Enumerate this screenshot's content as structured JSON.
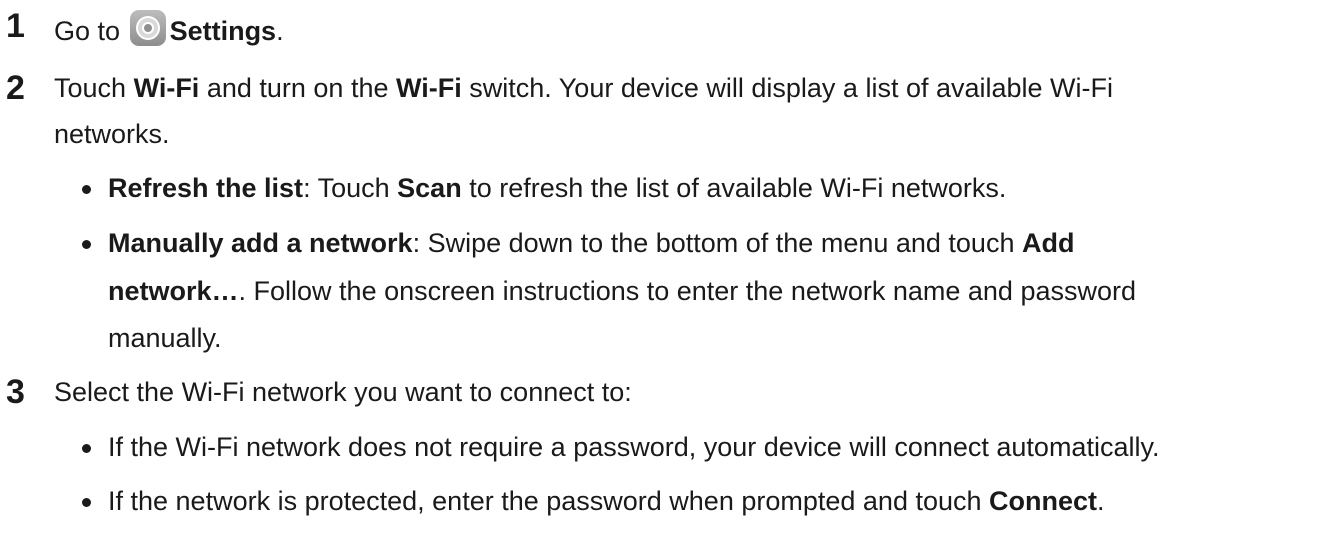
{
  "steps": [
    {
      "number": "1",
      "go_to": "Go to",
      "settings": "Settings",
      "period": ".",
      "icon": "settings-icon"
    },
    {
      "number": "2",
      "touch": "Touch",
      "wifi1": "Wi-Fi",
      "and_turn_on": "and turn on the",
      "wifi2": "Wi-Fi",
      "switch_text": "switch. Your device will display a list of available Wi-Fi",
      "cont": "networks.",
      "bullets": [
        {
          "bold1": "Refresh the list",
          "text1": ": Touch",
          "bold2": "Scan",
          "text2": "to refresh the list of available Wi-Fi networks."
        },
        {
          "bold1": "Manually add a network",
          "text1": ": Swipe down to the bottom of the menu and touch",
          "bold2": "Add",
          "bold3": "network…",
          "text2": ". Follow the onscreen instructions to enter the network name and password",
          "text3": "manually."
        }
      ]
    },
    {
      "number": "3",
      "text": "Select the Wi-Fi network you want to connect to:",
      "bullets": [
        {
          "text": "If the Wi-Fi network does not require a password, your device will connect automatically."
        },
        {
          "text": "If the network is protected, enter the password when prompted and touch",
          "bold": "Connect",
          "period": "."
        }
      ]
    }
  ]
}
